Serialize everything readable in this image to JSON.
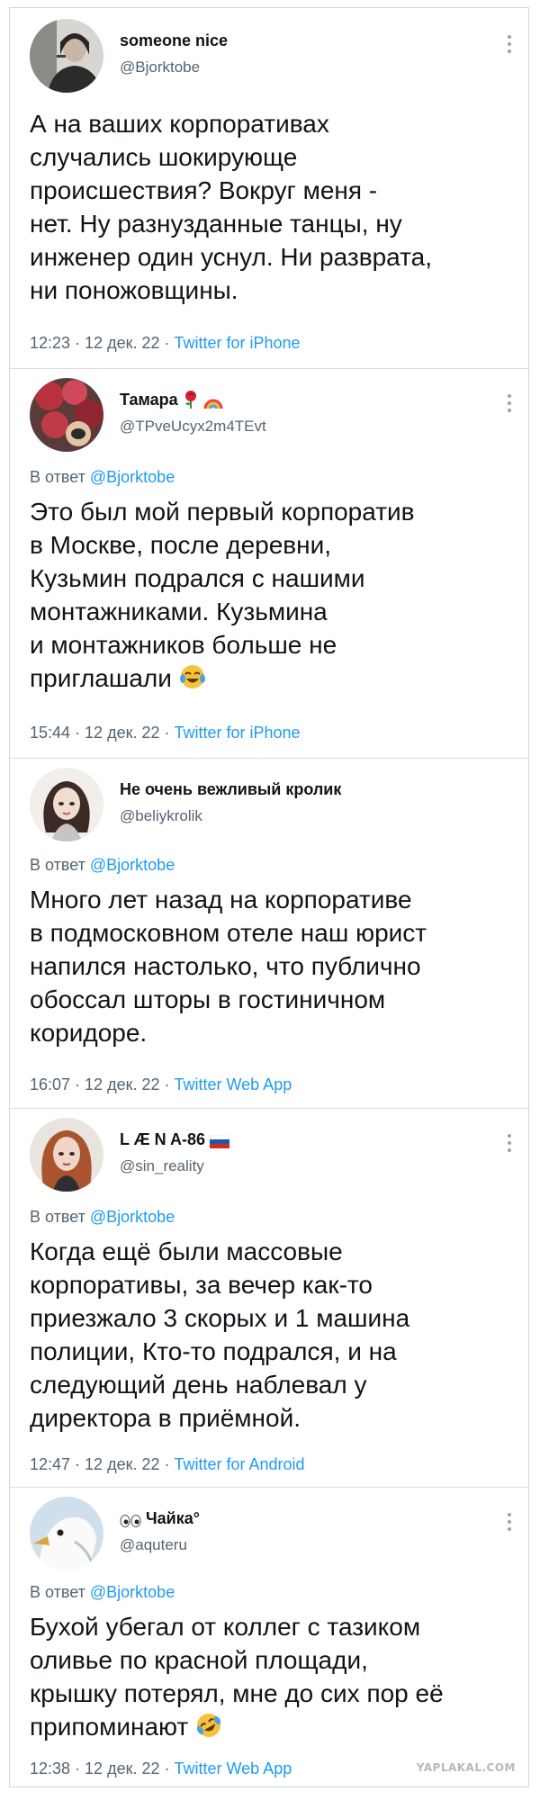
{
  "tweets": [
    {
      "name": "someone nice",
      "handle": "@Bjorktobe",
      "reply_prefix": "",
      "reply_handle": "",
      "lines": [
        "А на ваших корпоративах",
        "случались шокирующе",
        "происшествия? Вокруг меня -",
        "нет. Ну разнузданные танцы, ну",
        "инженер один уснул. Ни разврата,",
        "ни поножовщины."
      ],
      "time": "12:23 · 12 дек. 22 · ",
      "source": "Twitter for iPhone"
    },
    {
      "name": "Тамара",
      "handle": "@TPveUcyx2m4TEvt",
      "reply_prefix": "В ответ ",
      "reply_handle": "@Bjorktobe",
      "lines": [
        "Это был мой первый корпоратив",
        "в Москве, после деревни,",
        "Кузьмин подрался с нашими",
        "монтажниками. Кузьмина",
        "и монтажников больше не",
        "приглашали"
      ],
      "time": "15:44 · 12 дек. 22 · ",
      "source": "Twitter for iPhone"
    },
    {
      "name": "Не очень вежливый кролик",
      "handle": "@beliykrolik",
      "reply_prefix": "В ответ ",
      "reply_handle": "@Bjorktobe",
      "lines": [
        "Много лет назад на корпоративе",
        "в подмосковном отеле наш юрист",
        "напился настолько, что публично",
        "обоссал шторы в гостиничном",
        "коридоре."
      ],
      "time": "16:07 · 12 дек. 22 · ",
      "source": "Twitter Web App"
    },
    {
      "name": "L Æ N A-86",
      "handle": "@sin_reality",
      "reply_prefix": "В ответ ",
      "reply_handle": "@Bjorktobe",
      "lines": [
        "Когда ещё были массовые",
        "корпоративы, за вечер как-то",
        "приезжало 3 скорых и 1 машина",
        "полиции, Кто-то подрался, и на",
        "следующий день наблевал у",
        "директора в приёмной."
      ],
      "time": "12:47 · 12 дек. 22 · ",
      "source": "Twitter for Android"
    },
    {
      "name": "Чайка°",
      "handle": "@aquteru",
      "reply_prefix": "В ответ ",
      "reply_handle": "@Bjorktobe",
      "lines": [
        "Бухой убегал от коллег с тазиком",
        "оливье по красной площади,",
        "крышку потерял, мне до сих пор её",
        "припоминают"
      ],
      "time": "12:38 · 12 дек. 22 · ",
      "source": "Twitter Web App"
    }
  ],
  "watermark": "YAPLAKAL.COM",
  "colors": {
    "link": "#1d9bf0",
    "text": "#0f1419",
    "muted": "#536471",
    "divider": "#d9dee2"
  },
  "icons": [
    "more-icon",
    "rose-emoji-icon",
    "rainbow-emoji-icon",
    "tears-of-joy-emoji-icon",
    "russia-flag-icon",
    "eyes-emoji-icon",
    "rofl-emoji-icon"
  ]
}
